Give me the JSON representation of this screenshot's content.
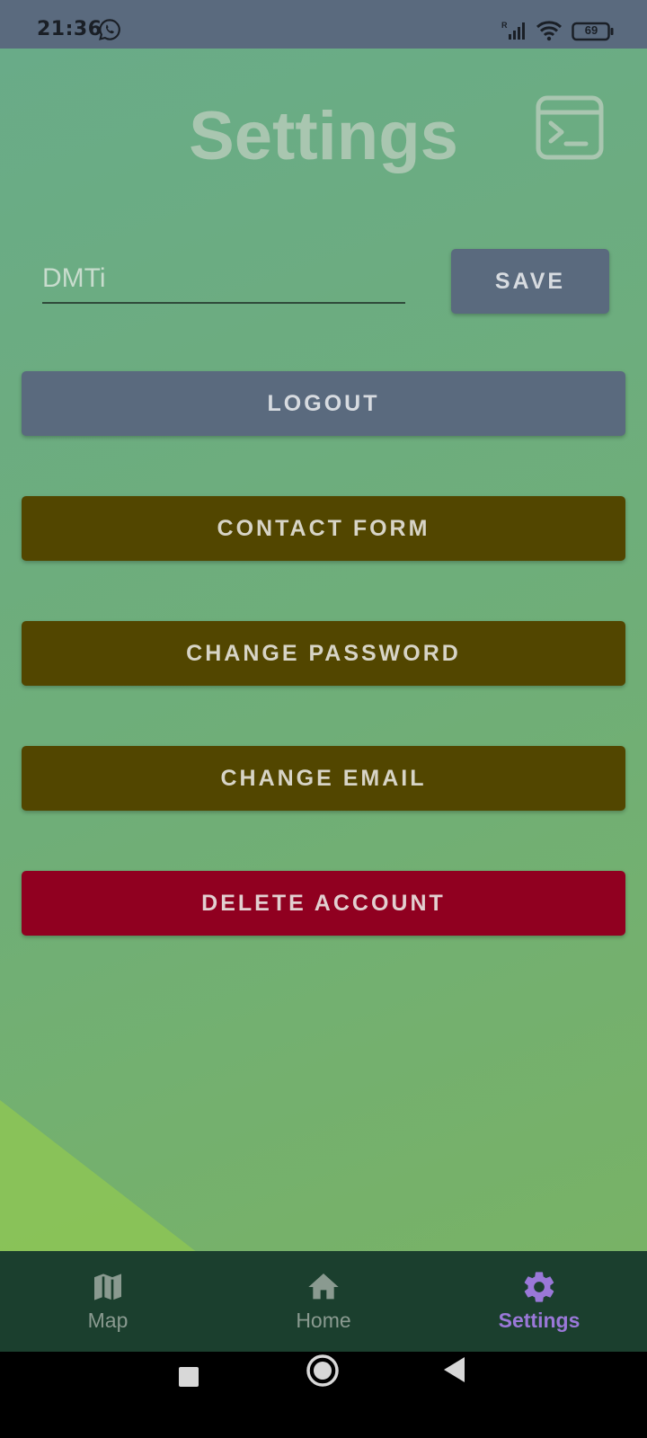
{
  "status_bar": {
    "time": "21:36",
    "battery": "69",
    "icons": [
      "whatsapp-icon",
      "signal-icon",
      "wifi-icon",
      "battery-icon"
    ]
  },
  "header": {
    "title": "Settings",
    "terminal_icon": "terminal-icon"
  },
  "profile": {
    "name_value": "DMTi",
    "save_label": "SAVE"
  },
  "actions": {
    "logout": "LOGOUT",
    "contact_form": "CONTACT FORM",
    "change_password": "CHANGE PASSWORD",
    "change_email": "CHANGE EMAIL",
    "delete_account": "DELETE ACCOUNT"
  },
  "bottom_nav": {
    "items": [
      {
        "label": "Map",
        "icon": "map-icon"
      },
      {
        "label": "Home",
        "icon": "home-icon"
      },
      {
        "label": "Settings",
        "icon": "gear-icon",
        "active": true
      }
    ]
  },
  "system_nav": {
    "icons": [
      "recents-icon",
      "home-circle-icon",
      "back-icon"
    ]
  },
  "colors": {
    "status_bar": "#5a6a7e",
    "background_top": "#69ab88",
    "background_bottom": "#78b266",
    "primary_button": "#5a6a7e",
    "secondary_button": "#524600",
    "danger_button": "#900020",
    "bottom_nav": "#1b3f2e",
    "active_nav": "#9a78d8"
  }
}
